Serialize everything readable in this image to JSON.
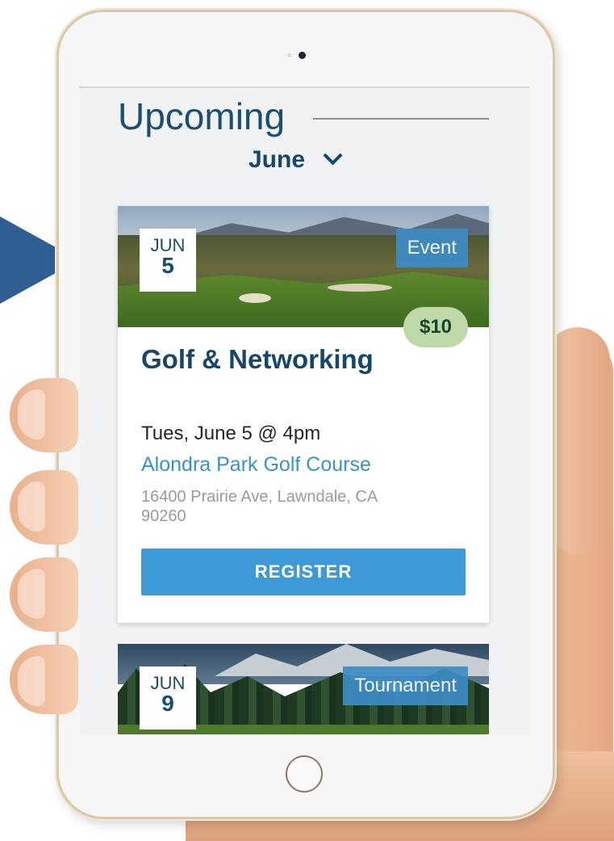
{
  "header": {
    "title": "Upcoming",
    "month": "June"
  },
  "events": [
    {
      "month": "JUN",
      "day": "5",
      "type": "Event",
      "price": "$10",
      "title": "Golf & Networking",
      "when": "Tues, June 5 @ 4pm",
      "venue": "Alondra Park Golf Course",
      "address": "16400 Prairie Ave, Lawndale, CA 90260",
      "register_label": "REGISTER"
    },
    {
      "month": "JUN",
      "day": "9",
      "type": "Tournament"
    }
  ],
  "colors": {
    "primary": "#1b4f72",
    "accent": "#3d9ad6",
    "tag": "#3d8cc6",
    "price_bg": "#bfd8a8",
    "arrow": "#2f5f93"
  },
  "icons": {
    "month_dropdown": "chevron-down-icon",
    "pointer": "arrow-right-icon"
  }
}
